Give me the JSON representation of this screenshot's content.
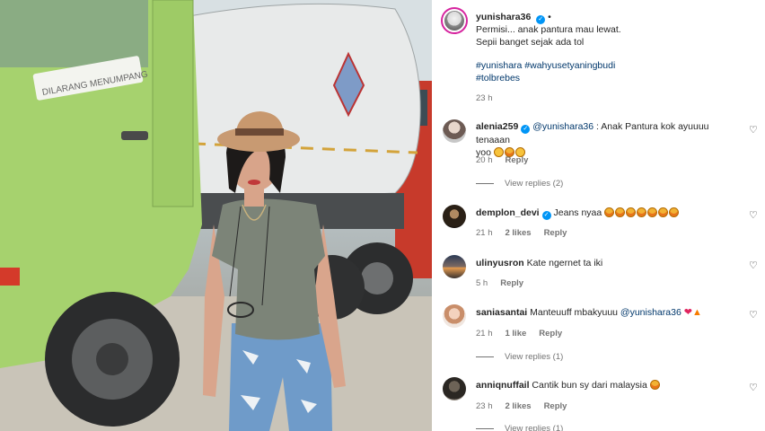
{
  "post": {
    "username": "yunishara36",
    "separator": "•",
    "caption_line1": "Permisi... anak pantura mau lewat.",
    "caption_line2": "Sepii banget sejak ada tol",
    "hashtags_line1": "#yunishara #wahyusetyaningbudi",
    "hashtags_line2": "#tolbrebes",
    "time": "23 h"
  },
  "photo": {
    "truck_sign": "DILARANG MENUMPANG"
  },
  "labels": {
    "reply": "Reply"
  },
  "comments": [
    {
      "username": "alenia259",
      "verified": true,
      "mention": "@yunishara36",
      "text": ": Anak Pantura kok ayuuuu tenaaan",
      "text_line2": "yoo",
      "time": "20 h",
      "likes": "",
      "view_replies": "View replies (2)"
    },
    {
      "username": "demplon_devi",
      "verified": true,
      "text": "Jeans nyaa",
      "time": "21 h",
      "likes": "2 likes",
      "view_replies": ""
    },
    {
      "username": "uliny.usron",
      "display": "ulinyusron",
      "verified": false,
      "text": "Kate ngernet ta iki",
      "time": "5 h",
      "likes": "",
      "view_replies": ""
    },
    {
      "username": "saniasantai",
      "verified": false,
      "text": "Manteuuff mbakyuuu",
      "mention": "@yunishara36",
      "time": "21 h",
      "likes": "1 like",
      "view_replies": "View replies (1)"
    },
    {
      "username": "anniqnuffail",
      "verified": false,
      "text": "Cantik bun sy dari malaysia",
      "time": "23 h",
      "likes": "2 likes",
      "view_replies": "View replies (1)"
    }
  ],
  "colors": {
    "verified": "#0095f6",
    "hashtag": "#00376b",
    "truck_cab": "#a6d26e",
    "meta_gray": "#737373"
  },
  "icons": {
    "like": "heart-outline-icon",
    "verified": "verified-badge-icon"
  }
}
